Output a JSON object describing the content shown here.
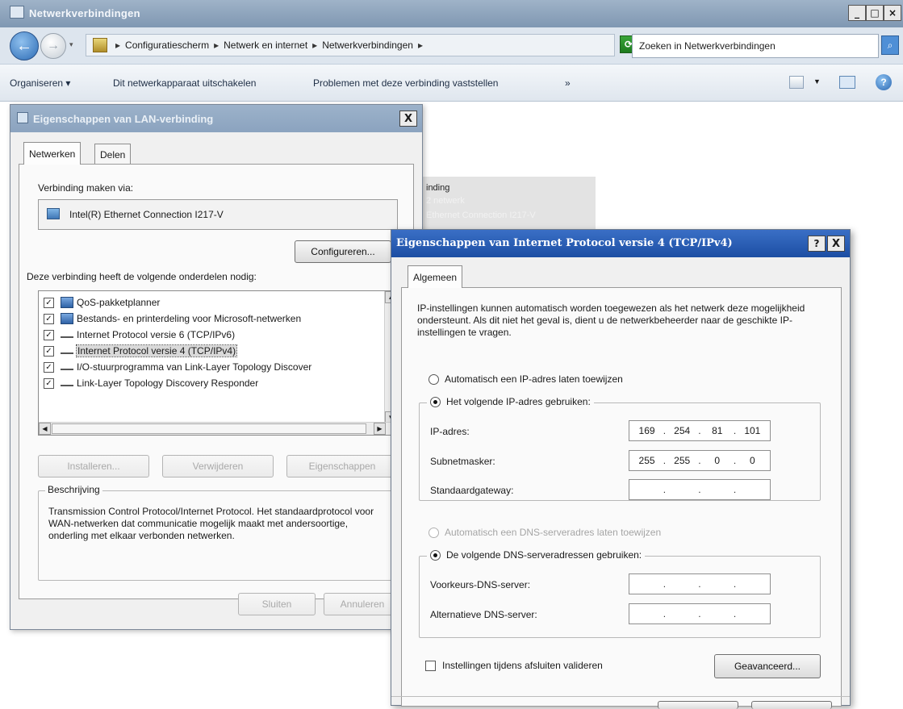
{
  "explorer": {
    "title": "Netwerkverbindingen",
    "breadcrumbs": [
      "Configuratiescherm",
      "Netwerk en internet",
      "Netwerkverbindingen"
    ],
    "search_placeholder": "Zoeken in Netwerkverbindingen",
    "toolbar": {
      "organize": "Organiseren",
      "disable": "Dit netwerkapparaat uitschakelen",
      "diagnose": "Problemen met deze verbinding vaststellen",
      "more": "»"
    },
    "background_item": {
      "line1": "inding",
      "line2": "2 netwerk",
      "line3": "Ethernet Connection I217-V"
    }
  },
  "lan_dialog": {
    "title": "Eigenschappen van LAN-verbinding",
    "tabs": [
      "Netwerken",
      "Delen"
    ],
    "connect_via_label": "Verbinding maken via:",
    "adapter_name": "Intel(R) Ethernet Connection I217-V",
    "configure_button": "Configureren...",
    "components_label": "Deze verbinding heeft de volgende onderdelen nodig:",
    "components": [
      {
        "label": "QoS-pakketplanner",
        "checked": true,
        "icon": "service-icon"
      },
      {
        "label": "Bestands- en printerdeling voor Microsoft-netwerken",
        "checked": true,
        "icon": "service-icon"
      },
      {
        "label": "Internet Protocol versie 6 (TCP/IPv6)",
        "checked": true,
        "icon": "protocol-icon"
      },
      {
        "label": "Internet Protocol versie 4 (TCP/IPv4)",
        "checked": true,
        "icon": "protocol-icon",
        "selected": true
      },
      {
        "label": "I/O-stuurprogramma van Link-Layer Topology Discover",
        "checked": true,
        "icon": "protocol-icon"
      },
      {
        "label": "Link-Layer Topology Discovery Responder",
        "checked": true,
        "icon": "protocol-icon"
      }
    ],
    "install_button": "Installeren...",
    "uninstall_button": "Verwijderen",
    "properties_button": "Eigenschappen",
    "description_legend": "Beschrijving",
    "description_text": "Transmission Control Protocol/Internet Protocol. Het standaardprotocol voor WAN-netwerken dat communicatie mogelijk maakt met andersoortige, onderling met elkaar verbonden netwerken.",
    "close_button": "Sluiten",
    "cancel_button": "Annuleren"
  },
  "ip_dialog": {
    "title": "Eigenschappen van Internet Protocol versie 4 (TCP/IPv4)",
    "help_glyph": "?",
    "close_glyph": "X",
    "tab": "Algemeen",
    "intro": "IP-instellingen kunnen automatisch worden toegewezen als het netwerk deze mogelijkheid ondersteunt. Als dit niet het geval is, dient u de netwerkbeheerder naar de geschikte IP-instellingen te vragen.",
    "auto_ip_label": "Automatisch een IP-adres laten toewijzen",
    "manual_ip_label": "Het volgende IP-adres gebruiken:",
    "ip_address_label": "IP-adres:",
    "ip_address": [
      "169",
      "254",
      "81",
      "101"
    ],
    "subnet_label": "Subnetmasker:",
    "subnet": [
      "255",
      "255",
      "0",
      "0"
    ],
    "gateway_label": "Standaardgateway:",
    "auto_dns_label": "Automatisch een DNS-serveradres laten toewijzen",
    "manual_dns_label": "De volgende DNS-serveradressen gebruiken:",
    "preferred_dns_label": "Voorkeurs-DNS-server:",
    "alternate_dns_label": "Alternatieve DNS-server:",
    "validate_label": "Instellingen tijdens afsluiten valideren",
    "advanced_button": "Geavanceerd..."
  }
}
